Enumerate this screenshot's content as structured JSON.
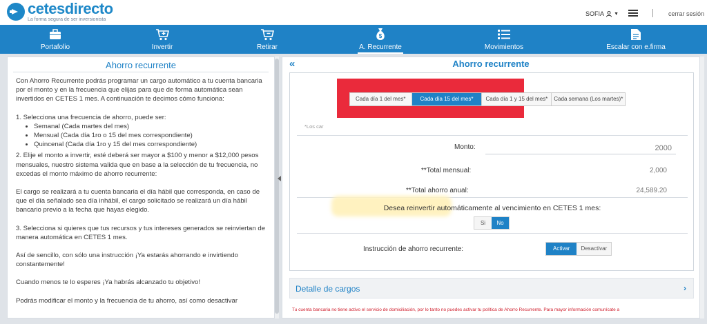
{
  "header": {
    "brand": "cetesdirecto",
    "tagline": "La forma segura de ser inversionista",
    "user": "SOFIA",
    "logout": "cerrar sesión"
  },
  "nav": [
    {
      "label": "Portafolio",
      "icon": "briefcase-icon"
    },
    {
      "label": "Invertir",
      "icon": "cart-add-icon"
    },
    {
      "label": "Retirar",
      "icon": "cart-remove-icon"
    },
    {
      "label": "A. Recurrente",
      "icon": "money-bag-icon"
    },
    {
      "label": "Movimientos",
      "icon": "list-icon"
    },
    {
      "label": "Escalar con e.firma",
      "icon": "document-icon"
    }
  ],
  "left": {
    "title": "Ahorro recurrente",
    "intro": "Con Ahorro Recurrente podrás programar un cargo automático a tu cuenta bancaria por el monto y en la frecuencia que elijas para que de forma automática sean invertidos en CETES 1 mes. A continuación te decimos cómo funciona:",
    "step1": "1. Selecciona una frecuencia de ahorro, puede ser:",
    "freqs": [
      "Semanal (Cada martes del mes)",
      "Mensual (Cada día 1ro o 15 del mes correspondiente)",
      "Quincenal (Cada día 1ro y 15 del mes correspondiente)"
    ],
    "step2": "2. Elije el monto a invertir, esté deberá ser mayor a $100 y menor a $12,000 pesos mensuales, nuestro sistema valida que en base a la selección de tu frecuencia, no excedas el monto máximo de ahorro recurrente:",
    "charge": "El cargo se realizará a tu cuenta bancaria el día hábil que corresponda, en caso de que el día señalado sea día inhábil, el cargo solicitado se realizará un día hábil bancario previo a la fecha que hayas elegido.",
    "step3": "3. Selecciona si quieres que tus recursos y tus intereses generados se reinviertan de manera automática en CETES 1 mes.",
    "simple": "Así de sencillo, con sólo una instrucción ¡Ya estarás ahorrando e invirtiendo constantemente!",
    "goal": "Cuando menos te lo esperes ¡Ya habrás alcanzado tu objetivo!",
    "modify": "Podrás modificar el monto y la frecuencia de tu ahorro, así como desactivar"
  },
  "right": {
    "title": "Ahorro recurrente",
    "freq_options": [
      "Cada día 1 del mes*",
      "Cada día 15 del mes*",
      "Cada día 1 y 15 del mes*",
      "Cada semana (Los martes)*"
    ],
    "freq_selected": 1,
    "note": "*Los car",
    "monto_label": "Monto:",
    "monto_value": "2000",
    "total_mensual_label": "**Total mensual:",
    "total_mensual_value": "2,000",
    "total_anual_label": "**Total ahorro anual:",
    "total_anual_value": "24,589.20",
    "reinvest_label": "Desea reinvertir automáticamente al vencimiento en CETES 1 mes:",
    "reinvest_si": "Si",
    "reinvest_no": "No",
    "instruction_label": "Instrucción de ahorro recurrente:",
    "activar": "Activar",
    "desactivar": "Desactivar",
    "detalle": "Detalle de cargos",
    "warning": "Tu cuenta bancaria no tiene activo el servicio de domiciliación, por lo tanto no puedes activar tu política de Ahorro Recurrente. Para mayor información comunícate a"
  },
  "colors": {
    "primary": "#1f82c6",
    "highlight_red": "#ea2a3b",
    "warning_text": "#d0202e"
  }
}
